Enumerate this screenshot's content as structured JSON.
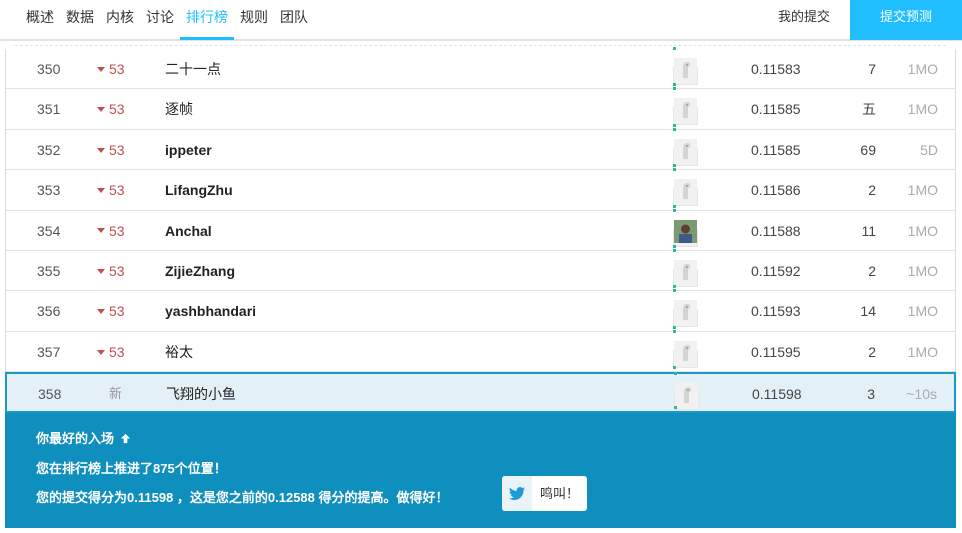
{
  "nav": {
    "tabs": [
      "概述",
      "数据",
      "内核",
      "讨论",
      "排行榜",
      "规则",
      "团队"
    ],
    "active_index": 4,
    "my_submissions": "我的提交",
    "submit_button": "提交预测"
  },
  "rows": [
    {
      "rank": "350",
      "move": "53",
      "name": "二十一点",
      "bold": false,
      "score": "0.11583",
      "entries": "7",
      "last": "1MO",
      "avatar": "default"
    },
    {
      "rank": "351",
      "move": "53",
      "name": "逐帧",
      "bold": false,
      "score": "0.11585",
      "entries": "五",
      "last": "1MO",
      "avatar": "default"
    },
    {
      "rank": "352",
      "move": "53",
      "name": "ippeter",
      "bold": true,
      "score": "0.11585",
      "entries": "69",
      "last": "5D",
      "avatar": "default"
    },
    {
      "rank": "353",
      "move": "53",
      "name": "LifangZhu",
      "bold": true,
      "score": "0.11586",
      "entries": "2",
      "last": "1MO",
      "avatar": "default"
    },
    {
      "rank": "354",
      "move": "53",
      "name": "Anchal",
      "bold": true,
      "score": "0.11588",
      "entries": "11",
      "last": "1MO",
      "avatar": "photo"
    },
    {
      "rank": "355",
      "move": "53",
      "name": "ZijieZhang",
      "bold": true,
      "score": "0.11592",
      "entries": "2",
      "last": "1MO",
      "avatar": "default"
    },
    {
      "rank": "356",
      "move": "53",
      "name": "yashbhandari",
      "bold": true,
      "score": "0.11593",
      "entries": "14",
      "last": "1MO",
      "avatar": "default"
    },
    {
      "rank": "357",
      "move": "53",
      "name": "裕太",
      "bold": false,
      "score": "0.11595",
      "entries": "2",
      "last": "1MO",
      "avatar": "default"
    }
  ],
  "my_row": {
    "rank": "358",
    "move": "新",
    "name": "飞翔的小鱼",
    "score": "0.11598",
    "entries": "3",
    "last": "~10s"
  },
  "banner": {
    "title": "你最好的入场",
    "line1": "您在排行榜上推进了875个位置！",
    "line2": "您的提交得分为0.11598 ，这是您之前的0.12588 得分的提高。做得好！",
    "tweet_label": "鸣叫！"
  },
  "colors": {
    "accent": "#20beff",
    "banner": "#0f8fbd",
    "down": "#c0504d"
  }
}
